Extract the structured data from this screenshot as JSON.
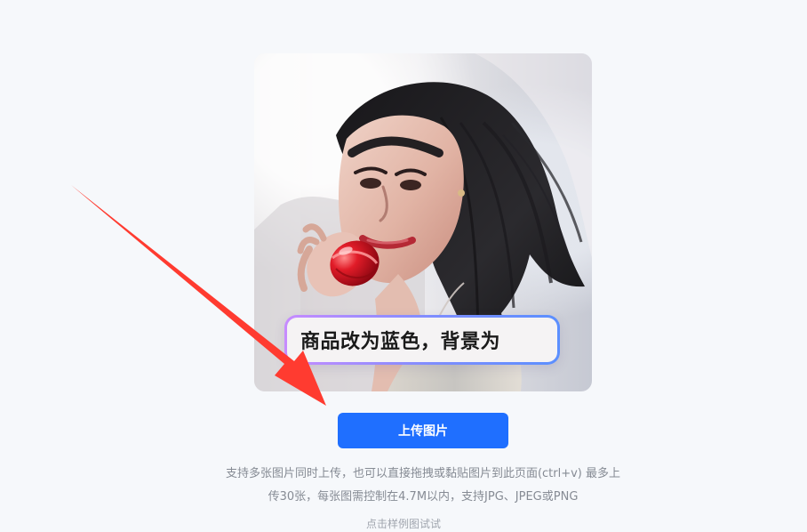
{
  "preview": {
    "prompt_text": "商品改为蓝色，背景为"
  },
  "upload": {
    "button_label": "上传图片",
    "help_text": "支持多张图片同时上传，也可以直接拖拽或黏贴图片到此页面(ctrl+v) 最多上传30张，每张图需控制在4.7M以内，支持JPG、JPEG或PNG",
    "footer_hint": "点击样例图试试"
  },
  "colors": {
    "page_background": "#f6f8fb",
    "button_primary": "#1f6fff",
    "arrow": "#ff3b30",
    "product_red": "#d60f1f"
  },
  "icons": {
    "overlay_arrow": "red-pointer-arrow-icon"
  }
}
